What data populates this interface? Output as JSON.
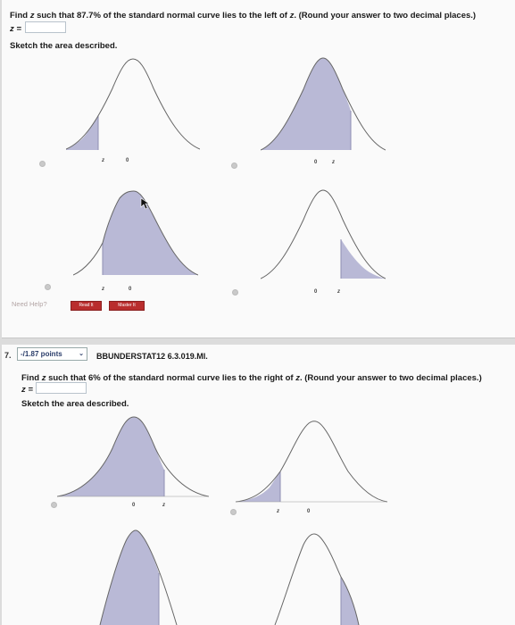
{
  "q1": {
    "text_before": "Find ",
    "z_var": "z",
    "text_mid": " such that 87.7% of the standard normal curve lies to the left of ",
    "text_after": ". (Round your answer to two decimal places.)",
    "z_label": "z =",
    "sketch_label": "Sketch the area described.",
    "ticks": {
      "zero": "0",
      "z": "z"
    },
    "help": {
      "label": "Need Help?",
      "read_label": "Read It",
      "master_label": "Master It"
    }
  },
  "q2": {
    "number": "7.",
    "points": "-/1.87 points",
    "dropdown_icon": "chevron-down-icon",
    "code": "BBUNDERSTAT12 6.3.019.MI.",
    "text_before": "Find ",
    "z_var": "z",
    "text_mid": " such that 6% of the standard normal curve lies to the right of ",
    "text_after": ". (Round your answer to two decimal places.)",
    "z_label": "z =",
    "sketch_label": "Sketch the area described.",
    "ticks": {
      "zero": "0",
      "z": "z"
    }
  },
  "colors": {
    "shade": "#b9b9d6",
    "shade_edge": "#8f8fb3",
    "curve": "#666666",
    "help_button": "#b92d2d"
  }
}
